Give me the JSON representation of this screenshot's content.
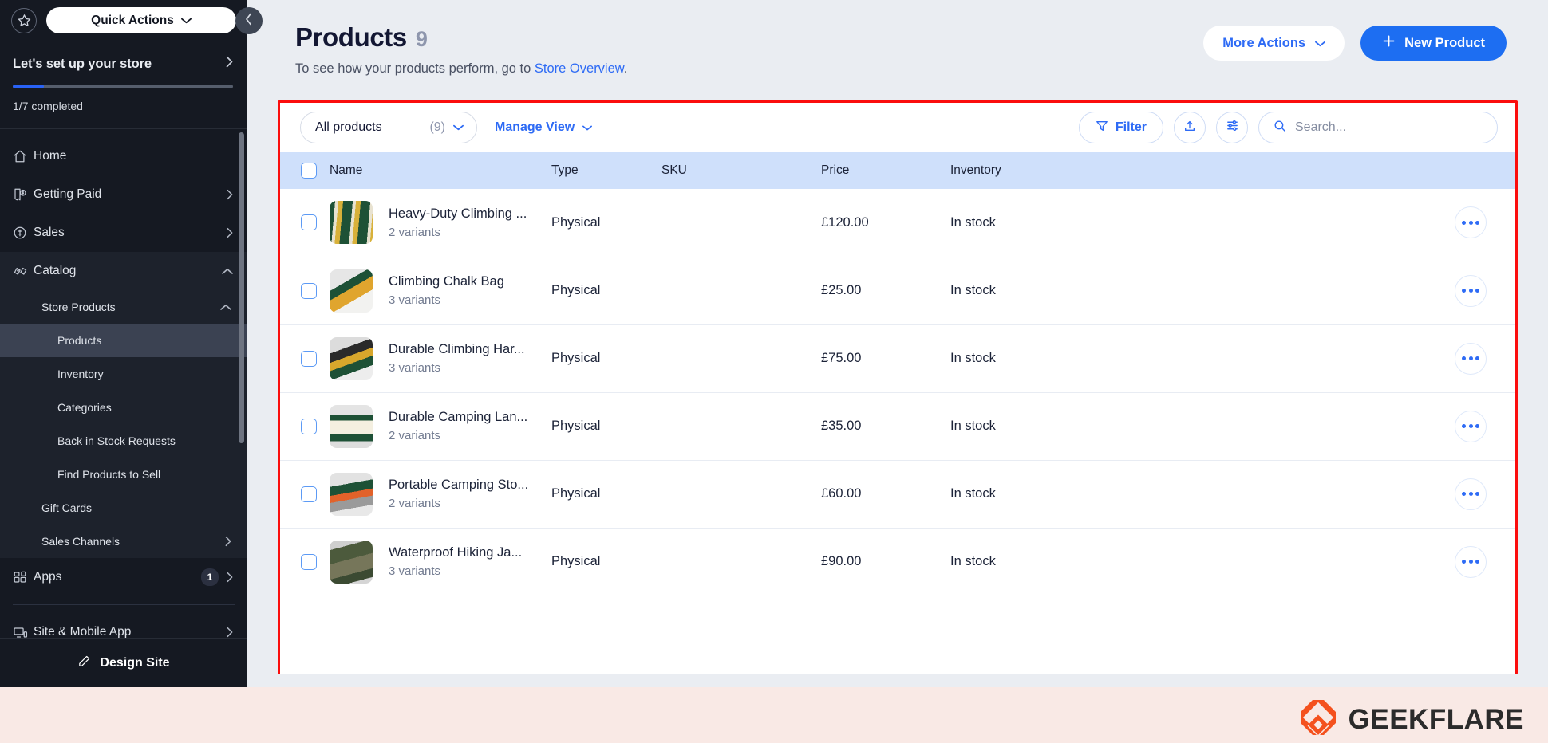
{
  "sidebar": {
    "star_icon": "star-icon",
    "quick_actions": {
      "label": "Quick Actions",
      "chevron": "chevron-down-icon"
    },
    "setup": {
      "title": "Let's set up your store",
      "chevron": "chevron-right-icon",
      "progress_percent": 14,
      "progress_text": "1/7 completed"
    },
    "nav": [
      {
        "label": "Home",
        "icon": "home-icon",
        "chevron": ""
      },
      {
        "label": "Getting Paid",
        "icon": "receipt-dollar-icon",
        "chevron": "chevron-right-icon"
      },
      {
        "label": "Sales",
        "icon": "coin-dollar-icon",
        "chevron": "chevron-right-icon"
      },
      {
        "label": "Catalog",
        "icon": "tags-icon",
        "chevron": "chevron-up-icon"
      }
    ],
    "catalog_children": [
      {
        "label": "Store Products",
        "level": 1,
        "chevron": "chevron-up-icon",
        "active": false
      },
      {
        "label": "Products",
        "level": 2,
        "chevron": "",
        "active": true
      },
      {
        "label": "Inventory",
        "level": 2,
        "chevron": "",
        "active": false
      },
      {
        "label": "Categories",
        "level": 2,
        "chevron": "",
        "active": false
      },
      {
        "label": "Back in Stock Requests",
        "level": 2,
        "chevron": "",
        "active": false
      },
      {
        "label": "Find Products to Sell",
        "level": 2,
        "chevron": "",
        "active": false
      },
      {
        "label": "Gift Cards",
        "level": 1,
        "chevron": "",
        "active": false
      },
      {
        "label": "Sales Channels",
        "level": 1,
        "chevron": "chevron-right-icon",
        "active": false
      }
    ],
    "apps": {
      "label": "Apps",
      "icon": "apps-grid-icon",
      "badge": "1",
      "chevron": "chevron-right-icon"
    },
    "site_mobile": {
      "label": "Site & Mobile App",
      "icon": "monitor-mobile-icon",
      "chevron": "chevron-right-icon"
    },
    "design_site": {
      "label": "Design Site",
      "icon": "pencil-icon"
    },
    "collapse": {
      "icon": "chevron-left-icon"
    }
  },
  "header": {
    "title": "Products",
    "count": "9",
    "subtitle_prefix": "To see how your products perform, go to ",
    "subtitle_link": "Store Overview",
    "subtitle_suffix": ".",
    "more_actions": {
      "label": "More Actions",
      "chevron": "chevron-down-icon"
    },
    "new_product": {
      "label": "New Product",
      "icon": "plus-icon"
    }
  },
  "toolbar": {
    "view_select": {
      "label": "All products",
      "count": "(9)",
      "chevron": "chevron-down-icon"
    },
    "manage_view": {
      "label": "Manage View",
      "chevron": "chevron-down-icon"
    },
    "filter": {
      "label": "Filter",
      "icon": "funnel-icon"
    },
    "export": {
      "icon": "upload-icon"
    },
    "settings": {
      "icon": "sliders-icon"
    },
    "search": {
      "placeholder": "Search...",
      "value": "",
      "icon": "search-icon"
    }
  },
  "table": {
    "columns": [
      "Name",
      "Type",
      "SKU",
      "Price",
      "Inventory"
    ],
    "select_all_checked": false,
    "row_action_icon": "ellipsis-icon",
    "rows": [
      {
        "name": "Heavy-Duty Climbing ...",
        "variants": "2 variants",
        "type": "Physical",
        "sku": "",
        "price": "£120.00",
        "inventory": "In stock",
        "thumb": "climbing-rope-thumbnail",
        "checked": false
      },
      {
        "name": "Climbing Chalk Bag",
        "variants": "3 variants",
        "type": "Physical",
        "sku": "",
        "price": "£25.00",
        "inventory": "In stock",
        "thumb": "chalk-bag-thumbnail",
        "checked": false
      },
      {
        "name": "Durable Climbing Har...",
        "variants": "3 variants",
        "type": "Physical",
        "sku": "",
        "price": "£75.00",
        "inventory": "In stock",
        "thumb": "climbing-harness-thumbnail",
        "checked": false
      },
      {
        "name": "Durable Camping Lan...",
        "variants": "2 variants",
        "type": "Physical",
        "sku": "",
        "price": "£35.00",
        "inventory": "In stock",
        "thumb": "camping-lantern-thumbnail",
        "checked": false
      },
      {
        "name": "Portable Camping Sto...",
        "variants": "2 variants",
        "type": "Physical",
        "sku": "",
        "price": "£60.00",
        "inventory": "In stock",
        "thumb": "camping-stove-thumbnail",
        "checked": false
      },
      {
        "name": "Waterproof Hiking Ja...",
        "variants": "3 variants",
        "type": "Physical",
        "sku": "",
        "price": "£90.00",
        "inventory": "In stock",
        "thumb": "hiking-jacket-thumbnail",
        "checked": false
      }
    ]
  },
  "watermark": {
    "text": "GEEKFLARE",
    "logo": "geekflare-logo-icon"
  },
  "colors": {
    "accent_blue": "#1d6ef2",
    "link_blue": "#2e6bf5",
    "sidebar_bg": "#151922",
    "table_header_bg": "#cfe0fb",
    "highlight_border": "#fb0d0d",
    "watermark_orange": "#f4511e",
    "page_bg": "#eaedf2"
  }
}
